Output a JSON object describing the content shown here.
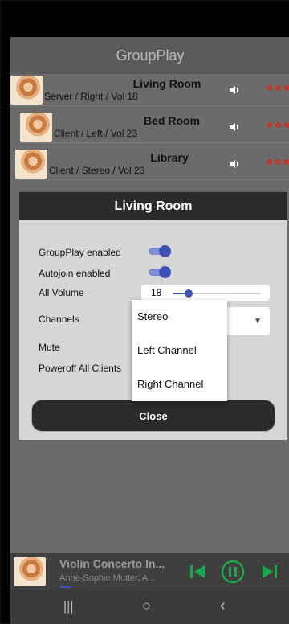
{
  "app": {
    "title": "GroupPlay"
  },
  "rooms": [
    {
      "name": "Living Room",
      "sub": "Server / Right / Vol 18"
    },
    {
      "name": "Bed Room",
      "sub": "Client / Left / Vol 23"
    },
    {
      "name": "Library",
      "sub": "Client / Stereo / Vol 23"
    }
  ],
  "icons": {
    "speaker": "volume-icon",
    "more": "more-dots-icon",
    "prev": "skip-previous-icon",
    "pause": "pause-icon",
    "next": "skip-next-icon"
  },
  "dialog": {
    "title": "Living Room",
    "groupplay_label": "GroupPlay enabled",
    "groupplay_enabled": true,
    "autojoin_label": "Autojoin enabled",
    "autojoin_enabled": true,
    "volume_label": "All Volume",
    "volume_value": "18",
    "volume_level_pct": 18,
    "channels_label": "Channels",
    "mute_label": "Mute",
    "poweroff_label": "Poweroff All Clients",
    "close_label": "Close"
  },
  "channel_menu": [
    "Stereo",
    "Left Channel",
    "Right Channel"
  ],
  "player": {
    "title": "Violin Concerto In...",
    "artist": "Anne-Sophie Mutter, A..."
  },
  "colors": {
    "accent": "#3f51b5",
    "danger_dots": "#c0392b",
    "player_controls": "#19a84a"
  }
}
